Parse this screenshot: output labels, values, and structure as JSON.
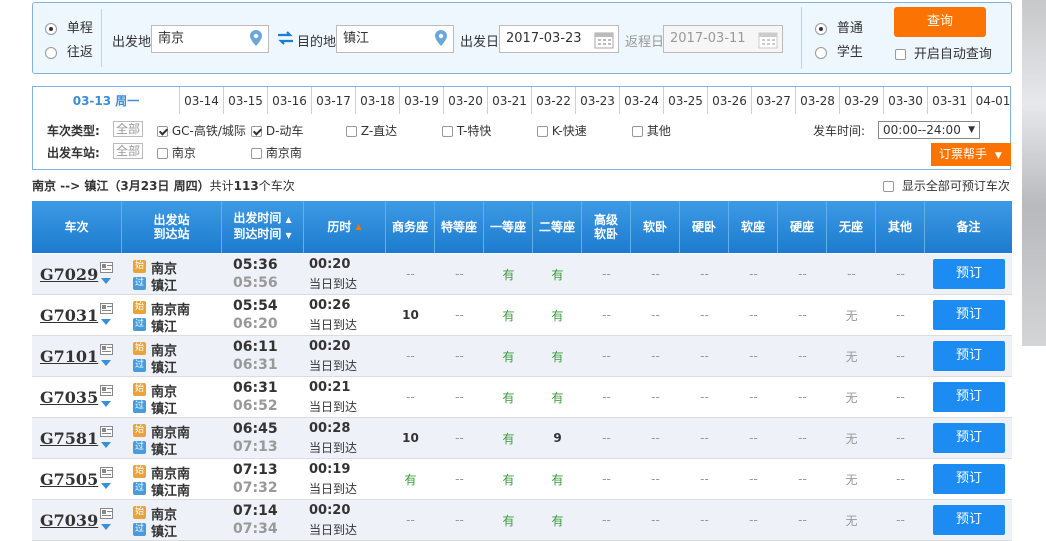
{
  "search": {
    "trip_types": [
      {
        "label": "单程",
        "selected": true
      },
      {
        "label": "往返",
        "selected": false
      }
    ],
    "from_label": "出发地",
    "from_value": "南京",
    "to_label": "目的地",
    "to_value": "镇江",
    "depart_label": "出发日",
    "depart_value": "2017-03-23",
    "return_label": "返程日",
    "return_value": "2017-03-11",
    "ticket_types": [
      {
        "label": "普通",
        "selected": true
      },
      {
        "label": "学生",
        "selected": false
      }
    ],
    "query_button": "查询",
    "auto_query_label": "开启自动查询"
  },
  "date_tabs": [
    "03-13 周一",
    "03-14",
    "03-15",
    "03-16",
    "03-17",
    "03-18",
    "03-19",
    "03-20",
    "03-21",
    "03-22",
    "03-23",
    "03-24",
    "03-25",
    "03-26",
    "03-27",
    "03-28",
    "03-29",
    "03-30",
    "03-31",
    "04-01"
  ],
  "filters": {
    "type_label": "车次类型:",
    "all_label": "全部",
    "types": [
      {
        "label": "GC-高铁/城际",
        "checked": true
      },
      {
        "label": "D-动车",
        "checked": true
      },
      {
        "label": "Z-直达",
        "checked": false
      },
      {
        "label": "T-特快",
        "checked": false
      },
      {
        "label": "K-快速",
        "checked": false
      },
      {
        "label": "其他",
        "checked": false
      }
    ],
    "station_label": "出发车站:",
    "stations": [
      {
        "label": "南京",
        "checked": false
      },
      {
        "label": "南京南",
        "checked": false
      }
    ],
    "time_label": "发车时间:",
    "time_value": "00:00--24:00",
    "help_button": "订票帮手"
  },
  "summary": {
    "route": "南京 --> 镇江（3月23日  周四）",
    "prefix": "共计",
    "count": "113",
    "suffix": "个车次",
    "show_all": "显示全部可预订车次"
  },
  "table": {
    "headers": {
      "train": "车次",
      "station1": "出发站",
      "station2": "到达站",
      "time1": "出发时间",
      "time2": "到达时间",
      "duration": "历时",
      "business": "商务座",
      "special": "特等座",
      "first": "一等座",
      "second": "二等座",
      "high_soft1": "高级",
      "high_soft2": "软卧",
      "soft_sleeper": "软卧",
      "hard_sleeper": "硬卧",
      "soft_seat": "软座",
      "hard_seat": "硬座",
      "no_seat": "无座",
      "other": "其他",
      "remark": "备注"
    },
    "book_label": "预订",
    "start_badge": "始",
    "pass_badge": "过",
    "rows": [
      {
        "train": "G7029",
        "from": "南京",
        "to": "镇江",
        "from_badge": "始",
        "to_badge": "过",
        "dep": "05:36",
        "arr": "05:56",
        "dur": "00:20",
        "day": "当日到达",
        "seats": [
          "--",
          "--",
          "有",
          "有",
          "--",
          "--",
          "--",
          "--",
          "--",
          "--",
          "--"
        ]
      },
      {
        "train": "G7031",
        "from": "南京南",
        "to": "镇江",
        "from_badge": "始",
        "to_badge": "过",
        "dep": "05:54",
        "arr": "06:20",
        "dur": "00:26",
        "day": "当日到达",
        "seats": [
          "10",
          "--",
          "有",
          "有",
          "--",
          "--",
          "--",
          "--",
          "--",
          "无",
          "--"
        ]
      },
      {
        "train": "G7101",
        "from": "南京",
        "to": "镇江",
        "from_badge": "始",
        "to_badge": "过",
        "dep": "06:11",
        "arr": "06:31",
        "dur": "00:20",
        "day": "当日到达",
        "seats": [
          "--",
          "--",
          "有",
          "有",
          "--",
          "--",
          "--",
          "--",
          "--",
          "无",
          "--"
        ]
      },
      {
        "train": "G7035",
        "from": "南京",
        "to": "镇江",
        "from_badge": "始",
        "to_badge": "过",
        "dep": "06:31",
        "arr": "06:52",
        "dur": "00:21",
        "day": "当日到达",
        "seats": [
          "--",
          "--",
          "有",
          "有",
          "--",
          "--",
          "--",
          "--",
          "--",
          "无",
          "--"
        ]
      },
      {
        "train": "G7581",
        "from": "南京南",
        "to": "镇江",
        "from_badge": "始",
        "to_badge": "过",
        "dep": "06:45",
        "arr": "07:13",
        "dur": "00:28",
        "day": "当日到达",
        "seats": [
          "10",
          "--",
          "有",
          "9",
          "--",
          "--",
          "--",
          "--",
          "--",
          "无",
          "--"
        ]
      },
      {
        "train": "G7505",
        "from": "南京南",
        "to": "镇江南",
        "from_badge": "始",
        "to_badge": "过",
        "dep": "07:13",
        "arr": "07:32",
        "dur": "00:19",
        "day": "当日到达",
        "seats": [
          "有",
          "--",
          "有",
          "有",
          "--",
          "--",
          "--",
          "--",
          "--",
          "无",
          "--"
        ]
      },
      {
        "train": "G7039",
        "from": "南京",
        "to": "镇江",
        "from_badge": "始",
        "to_badge": "过",
        "dep": "07:14",
        "arr": "07:34",
        "dur": "00:20",
        "day": "当日到达",
        "seats": [
          "--",
          "--",
          "有",
          "有",
          "--",
          "--",
          "--",
          "--",
          "--",
          "无",
          "--"
        ]
      }
    ]
  },
  "colors": {
    "accent": "#fb7403",
    "header_blue": "#1d7bcf",
    "book_blue": "#1c8bf2",
    "available_green": "#3b9a3b"
  }
}
